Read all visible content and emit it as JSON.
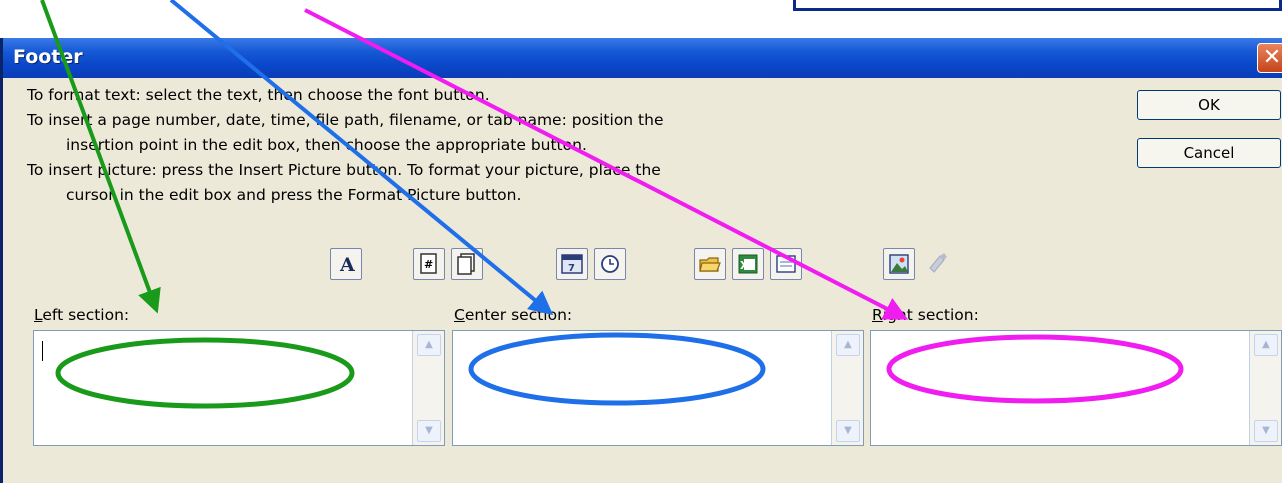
{
  "dialog": {
    "title": "Footer",
    "close_symbol": "✕",
    "instructions": [
      "To format text:  select the text, then choose the font button.",
      "To insert a page number, date, time, file path, filename, or tab name:  position the",
      "insertion point in the edit box, then choose the appropriate button.",
      "To insert picture: press the Insert Picture button.  To format your picture, place the",
      "cursor in the edit box and press the Format Picture button."
    ],
    "ok_label": "OK",
    "cancel_label": "Cancel"
  },
  "toolbar": {
    "buttons": [
      {
        "name": "format-text-icon",
        "glyph": "A"
      },
      {
        "name": "insert-page-number-icon",
        "glyph": "#"
      },
      {
        "name": "insert-number-of-pages-icon",
        "glyph": ""
      },
      {
        "name": "insert-date-icon",
        "glyph": "7"
      },
      {
        "name": "insert-time-icon",
        "glyph": ""
      },
      {
        "name": "insert-file-path-icon",
        "glyph": ""
      },
      {
        "name": "insert-file-name-icon",
        "glyph": ""
      },
      {
        "name": "insert-sheet-name-icon",
        "glyph": ""
      },
      {
        "name": "insert-picture-icon",
        "glyph": ""
      },
      {
        "name": "format-picture-icon",
        "glyph": ""
      }
    ]
  },
  "sections": {
    "left": {
      "label_accel": "L",
      "label_rest": "eft section:"
    },
    "center": {
      "label_accel": "C",
      "label_rest": "enter section:"
    },
    "right": {
      "label_accel": "R",
      "label_rest": "ight section:"
    }
  },
  "annotations": {
    "colors": {
      "left": "#1a9a1a",
      "center": "#1f6fe8",
      "right": "#f01cf0"
    }
  }
}
